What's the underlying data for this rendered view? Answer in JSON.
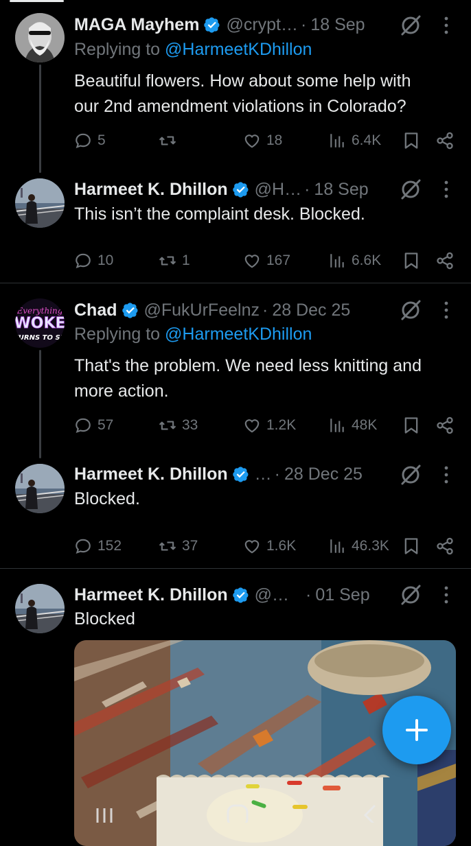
{
  "tweets": [
    {
      "name": "MAGA Mayhem",
      "handle": "@crypt…",
      "separator": "·",
      "date": "18 Sep",
      "replying_prefix": "Replying to ",
      "replying_to": "@HarmeetKDhillon",
      "text_lines": [
        "Beautiful flowers. How about some help with",
        "our 2nd amendment violations in Colorado?"
      ],
      "replies": "5",
      "reposts": "",
      "likes": "18",
      "views": "6.4K"
    },
    {
      "name": "Harmeet K. Dhillon",
      "handle": "@H…",
      "separator": "·",
      "date": "18 Sep",
      "replying_prefix": "",
      "replying_to": "",
      "text_lines": [
        "This isn’t the complaint desk. Blocked."
      ],
      "replies": "10",
      "reposts": "1",
      "likes": "167",
      "views": "6.6K"
    },
    {
      "name": "Chad",
      "handle": "@FukUrFeelnz",
      "separator": "·",
      "date": "28 Dec 25",
      "replying_prefix": "Replying to ",
      "replying_to": "@HarmeetKDhillon",
      "text_lines": [
        "That's the problem. We need less knitting and",
        "more action."
      ],
      "replies": "57",
      "reposts": "33",
      "likes": "1.2K",
      "views": "48K"
    },
    {
      "name": "Harmeet K. Dhillon",
      "handle": "…",
      "separator": "·",
      "date": "28 Dec 25",
      "replying_prefix": "",
      "replying_to": "",
      "text_lines": [
        "Blocked."
      ],
      "replies": "152",
      "reposts": "37",
      "likes": "1.6K",
      "views": "46.3K"
    },
    {
      "name": "Harmeet K. Dhillon",
      "handle": "@…",
      "separator": "·",
      "date": "01 Sep",
      "replying_prefix": "",
      "replying_to": "",
      "text_lines": [
        "Blocked"
      ]
    }
  ],
  "avatar_text": {
    "chad_line1": "Everything",
    "chad_line2": "WOKE",
    "chad_line3": "TURNS TO SH"
  },
  "icons": {
    "verified": "verified-badge-icon",
    "grok": "grok-icon",
    "more": "more-vertical-icon",
    "reply": "reply-bubble-icon",
    "repost": "repost-icon",
    "like": "heart-icon",
    "views": "views-bars-icon",
    "bookmark": "bookmark-icon",
    "share": "share-icon",
    "compose": "plus-icon"
  },
  "colors": {
    "accent": "#1d9bf0",
    "muted": "#71767b",
    "text": "#e7e9ea",
    "background": "#000000"
  }
}
